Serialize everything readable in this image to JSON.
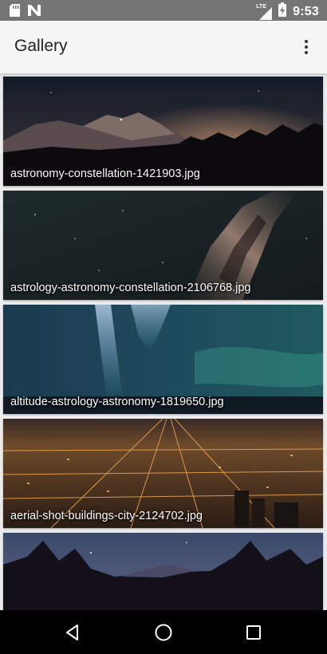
{
  "status_bar": {
    "time": "9:53",
    "network": "LTE",
    "icons": [
      "sd-card-icon",
      "n-notification-icon",
      "lte-signal-icon",
      "battery-charging-icon"
    ]
  },
  "app_bar": {
    "title": "Gallery",
    "overflow_icon": "more-vert-icon"
  },
  "gallery": {
    "items": [
      {
        "filename": "astronomy-constellation-1421903.jpg"
      },
      {
        "filename": "astrology-astronomy-constellation-2106768.jpg"
      },
      {
        "filename": "altitude-astrology-astronomy-1819650.jpg"
      },
      {
        "filename": "aerial-shot-buildings-city-2124702.jpg"
      },
      {
        "filename": ""
      }
    ]
  },
  "nav_bar": {
    "buttons": [
      "back-icon",
      "home-icon",
      "recents-icon"
    ]
  }
}
